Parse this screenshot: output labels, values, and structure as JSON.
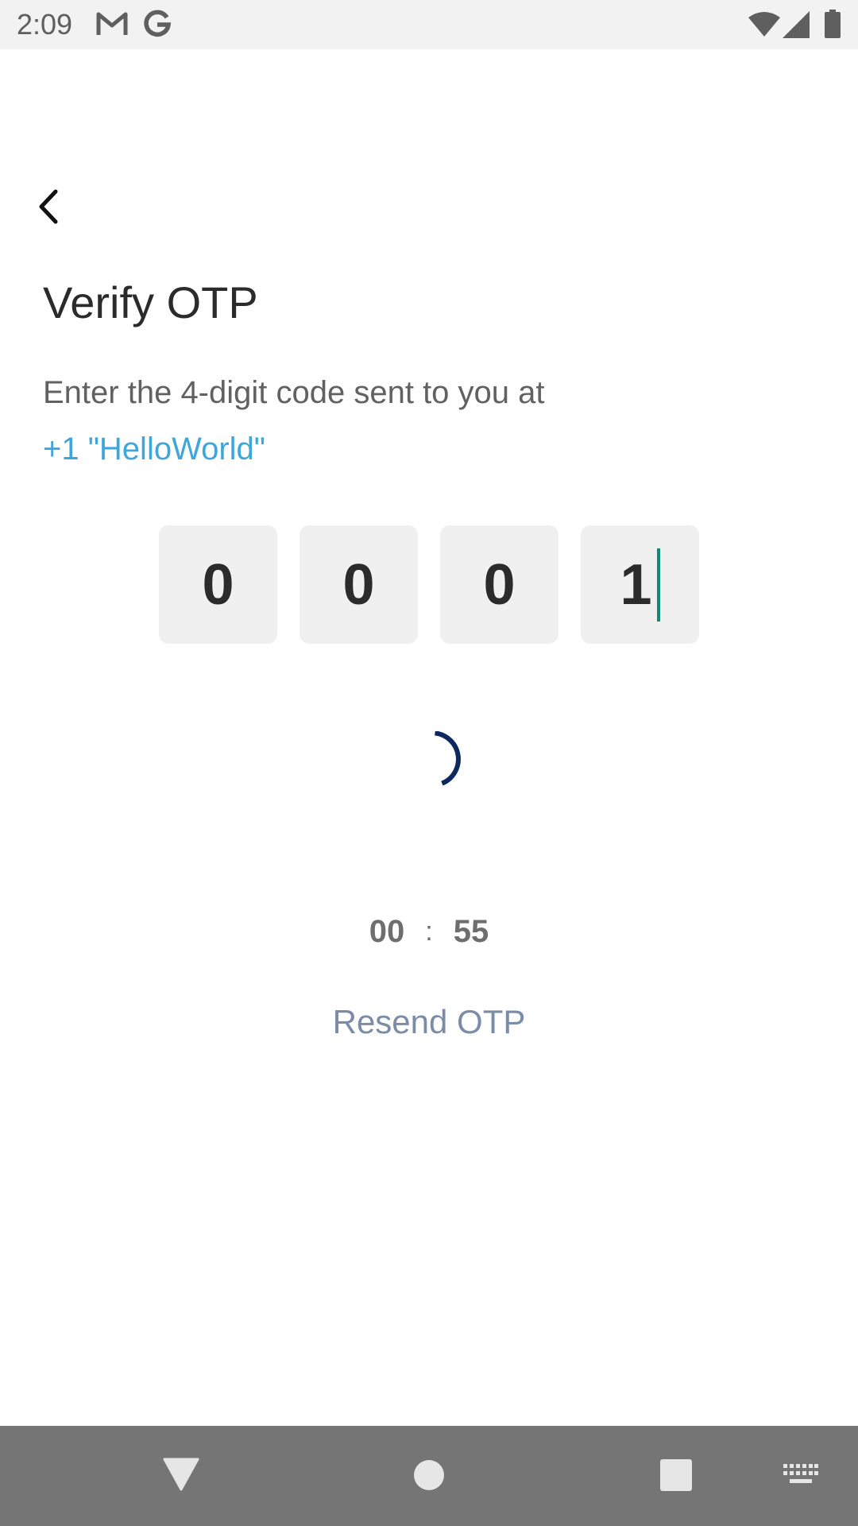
{
  "status_bar": {
    "time": "2:09",
    "icons": [
      "gmail-icon",
      "google-icon",
      "wifi-icon",
      "signal-icon",
      "battery-icon"
    ]
  },
  "header": {
    "back_icon": "chevron-left-icon"
  },
  "main": {
    "title": "Verify OTP",
    "instruction": "Enter the 4-digit code sent to you at",
    "phone": "+1 \"HelloWorld\"",
    "otp_digits": [
      "0",
      "0",
      "0",
      "1"
    ],
    "timer": {
      "minutes": "00",
      "separator": ":",
      "seconds": "55"
    },
    "resend_label": "Resend OTP"
  },
  "colors": {
    "accent": "#3ea6db",
    "caret": "#0f8a78",
    "spinner": "#0d2a5e",
    "resend": "#7a8ca8"
  },
  "nav_bar": {
    "icons": [
      "back-triangle-icon",
      "home-circle-icon",
      "recents-square-icon",
      "keyboard-icon"
    ]
  }
}
